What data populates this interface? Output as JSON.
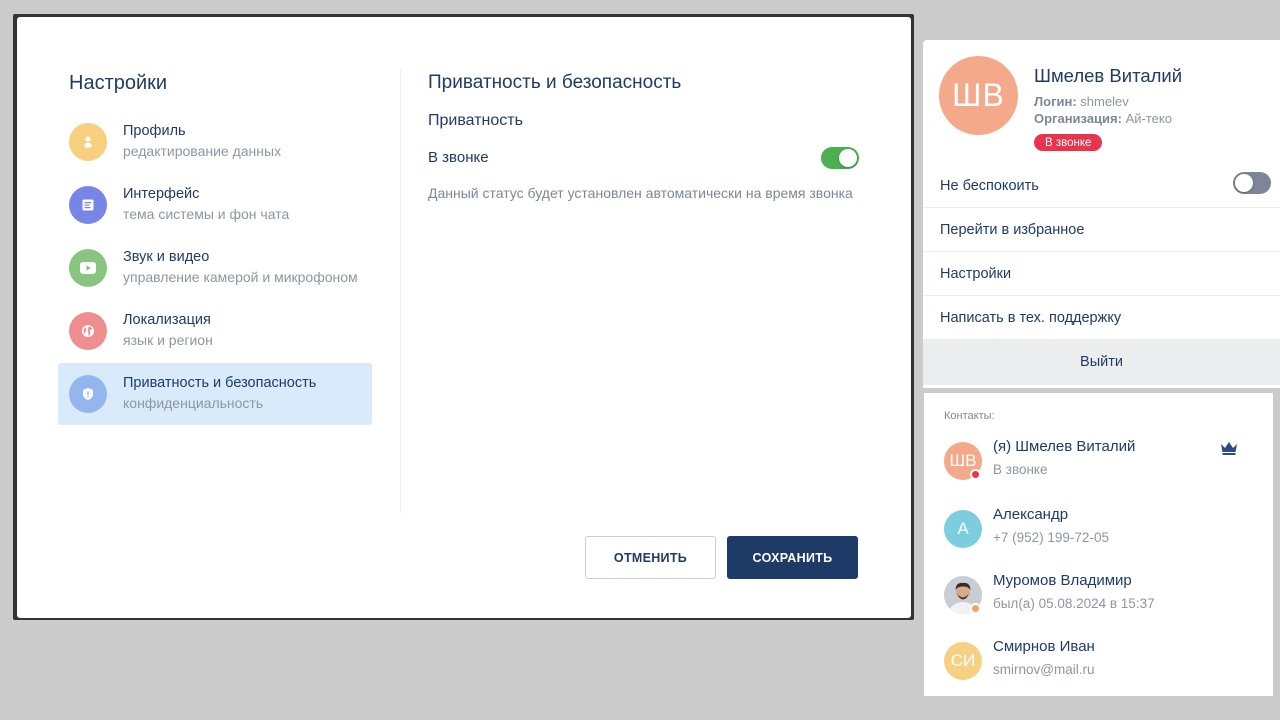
{
  "settings": {
    "title": "Настройки",
    "nav": [
      {
        "title": "Профиль",
        "sub": "редактирование данных",
        "icon": "person-icon",
        "color": "#f7cf7e"
      },
      {
        "title": "Интерфейс",
        "sub": "тема системы и фон чата",
        "icon": "interface-icon",
        "color": "#7785e6"
      },
      {
        "title": "Звук и видео",
        "sub": "управление камерой и микрофоном",
        "icon": "play-icon",
        "color": "#89c57f"
      },
      {
        "title": "Локализация",
        "sub": "язык и регион",
        "icon": "globe-icon",
        "color": "#ef8e8e"
      },
      {
        "title": "Приватность и безопасность",
        "sub": "конфиденциальность",
        "icon": "shield-icon",
        "color": "#94b6ee"
      }
    ],
    "active_index": 4,
    "section_title": "Приватность и безопасность",
    "sub_title": "Приватность",
    "option_label": "В звонке",
    "option_enabled": true,
    "option_desc": "Данный статус будет установлен автоматически на время звонка",
    "cancel_label": "ОТМЕНИТЬ",
    "save_label": "СОХРАНИТЬ"
  },
  "profile": {
    "initials": "ШВ",
    "name": "Шмелев Виталий",
    "login_label": "Логин:",
    "login": "shmelev",
    "org_label": "Организация:",
    "org": "Ай-теко",
    "status": "В звонке",
    "menu": {
      "dnd": "Не беспокоить",
      "favorites": "Перейти в избранное",
      "settings": "Настройки",
      "support": "Написать в тех. поддержку"
    },
    "dnd_enabled": false,
    "logout": "Выйти"
  },
  "contacts": {
    "title": "Контакты:",
    "items": [
      {
        "initials": "ШВ",
        "name": "(я) Шмелев Виталий",
        "sub": "В звонке",
        "avatar_color": "#f4a98a",
        "status_color": "#e8344d"
      },
      {
        "initials": "А",
        "name": "Александр",
        "sub": "+7 (952) 199-72-05",
        "avatar_color": "#7dcde0"
      },
      {
        "initials": "",
        "name": "Муромов Владимир",
        "sub": "был(а) 05.08.2024 в 15:37",
        "avatar_color": "#3a3f47",
        "status_color": "#f2a65a"
      },
      {
        "initials": "СИ",
        "name": "Смирнов Иван",
        "sub": "smirnov@mail.ru",
        "avatar_color": "#f6d184"
      }
    ]
  }
}
